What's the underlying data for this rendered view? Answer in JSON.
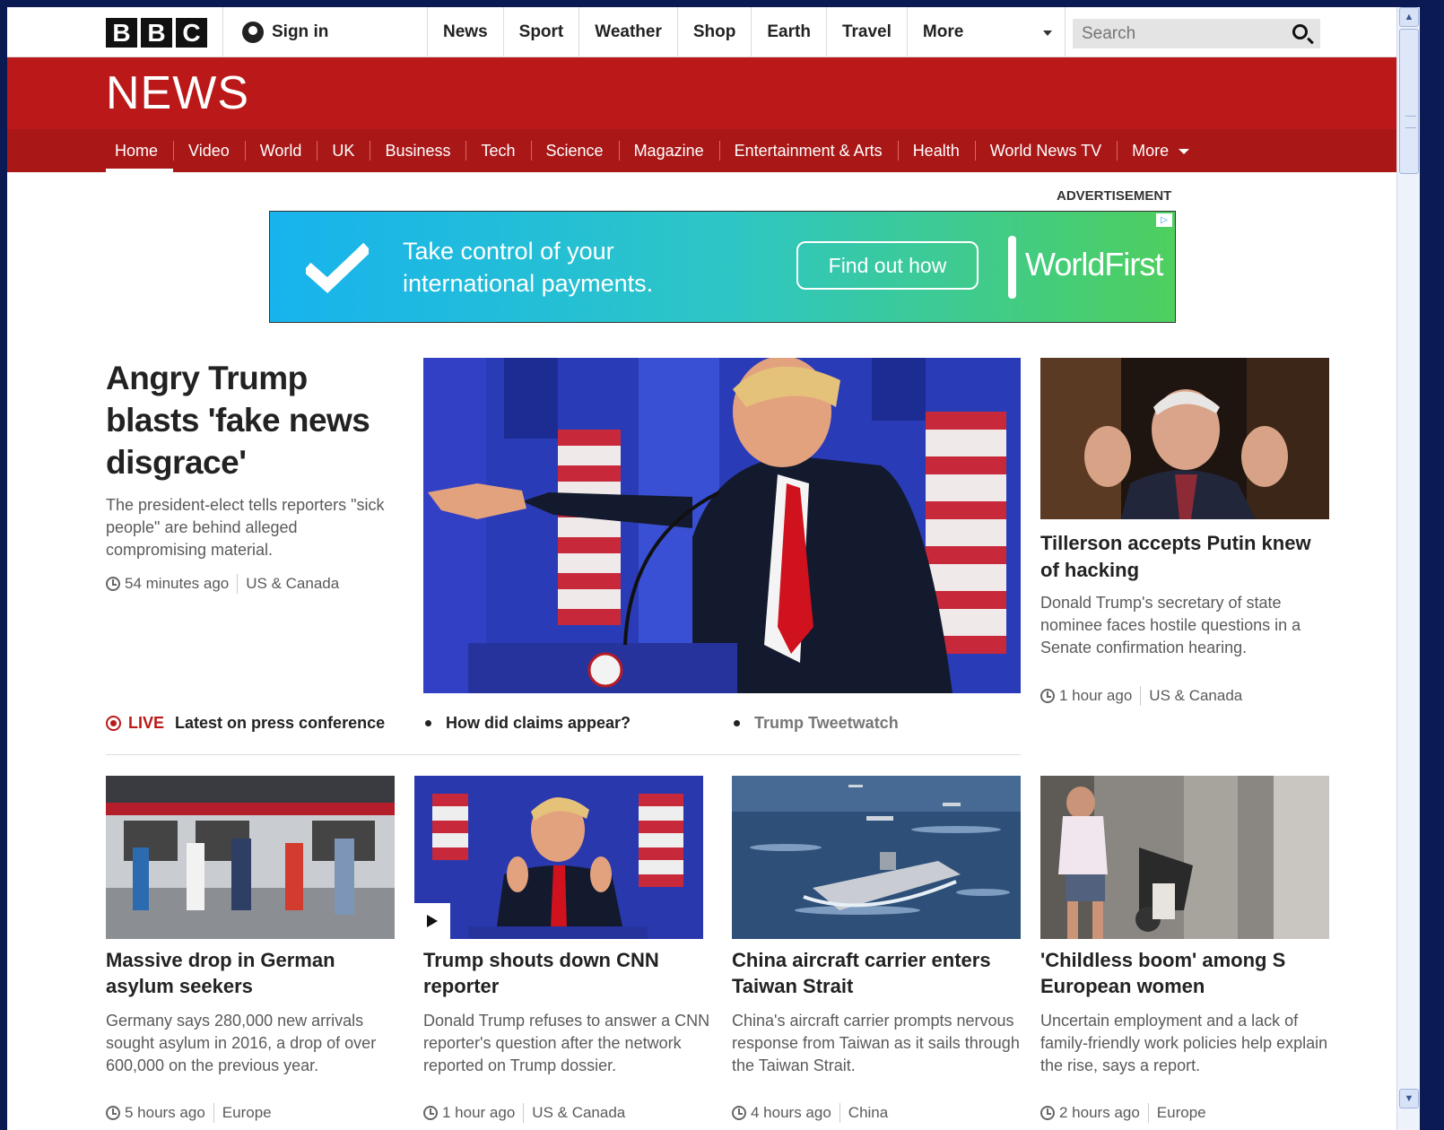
{
  "header": {
    "logo_letters": [
      "B",
      "B",
      "C"
    ],
    "sign_in": "Sign in",
    "global_nav": [
      "News",
      "Sport",
      "Weather",
      "Shop",
      "Earth",
      "Travel"
    ],
    "global_more": "More",
    "search_placeholder": "Search"
  },
  "news_header": {
    "logo": "NEWS",
    "sections": [
      "Home",
      "Video",
      "World",
      "UK",
      "Business",
      "Tech",
      "Science",
      "Magazine",
      "Entertainment & Arts",
      "Health",
      "World News TV"
    ],
    "more": "More",
    "active_section": "Home"
  },
  "ad": {
    "label": "ADVERTISEMENT",
    "text": "Take control of your international payments.",
    "button": "Find out how",
    "brand": "WorldFirst"
  },
  "lead": {
    "title": "Angry Trump blasts 'fake news disgrace'",
    "summary": "The president-elect tells reporters \"sick people\" are behind alleged compromising material.",
    "time": "54 minutes ago",
    "section": "US & Canada",
    "links": {
      "live_tag": "LIVE",
      "live_text": "Latest on press conference",
      "link2": "How did claims appear?",
      "link3": "Trump Tweetwatch"
    }
  },
  "side": {
    "title": "Tillerson accepts Putin knew of hacking",
    "summary": "Donald Trump's secretary of state nominee faces hostile questions in a Senate confirmation hearing.",
    "time": "1 hour ago",
    "section": "US & Canada"
  },
  "cards": [
    {
      "title": "Massive drop in German asylum seekers",
      "summary": "Germany says 280,000 new arrivals sought asylum in 2016, a drop of over 600,000 on the previous year.",
      "time": "5 hours ago",
      "section": "Europe"
    },
    {
      "title": "Trump shouts down CNN reporter",
      "summary": "Donald Trump refuses to answer a CNN reporter's question after the network reported on Trump dossier.",
      "time": "1 hour ago",
      "section": "US & Canada"
    },
    {
      "title": "China aircraft carrier enters Taiwan Strait",
      "summary": "China's aircraft carrier prompts nervous response from Taiwan as it sails through the Taiwan Strait.",
      "time": "4 hours ago",
      "section": "China"
    },
    {
      "title": "'Childless boom' among S European women",
      "summary": "Uncertain employment and a lack of family-friendly work policies help explain the rise, says a report.",
      "time": "2 hours ago",
      "section": "Europe"
    }
  ],
  "colors": {
    "brand_red": "#bb1919",
    "nav_red": "#a91717"
  }
}
